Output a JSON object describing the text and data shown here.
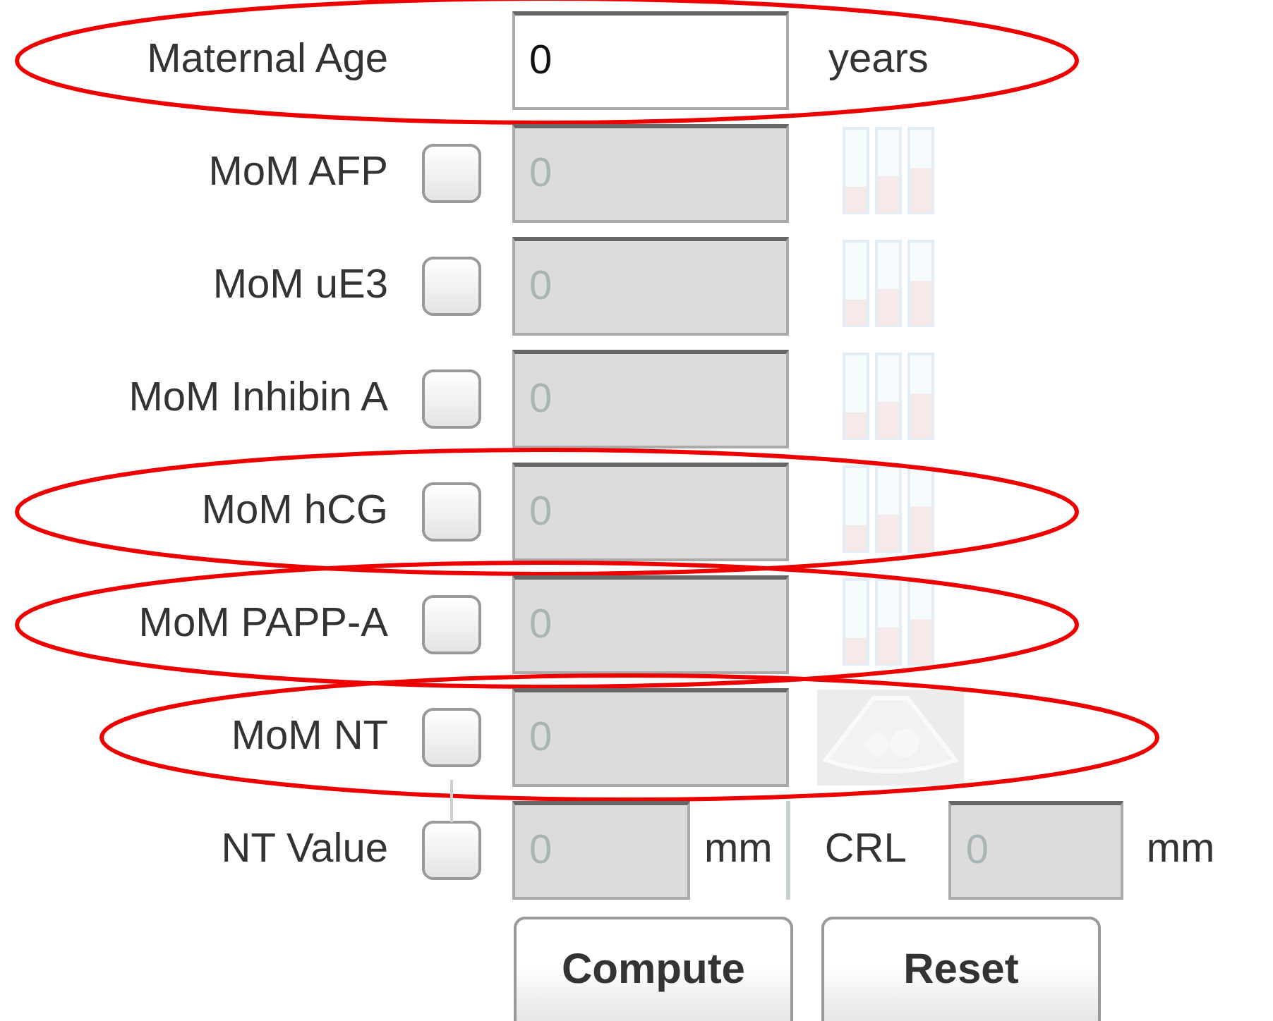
{
  "rows": [
    {
      "kind": "age",
      "label": "Maternal Age",
      "value": "0",
      "unit": "years",
      "circled": true
    },
    {
      "kind": "marker",
      "label": "MoM AFP",
      "checked": false,
      "value": "0",
      "circled": false
    },
    {
      "kind": "marker",
      "label": "MoM uE3",
      "checked": false,
      "value": "0",
      "circled": false
    },
    {
      "kind": "marker",
      "label": "MoM Inhibin A",
      "checked": false,
      "value": "0",
      "circled": false
    },
    {
      "kind": "marker",
      "label": "MoM hCG",
      "checked": false,
      "value": "0",
      "circled": true
    },
    {
      "kind": "marker",
      "label": "MoM PAPP-A",
      "checked": false,
      "value": "0",
      "circled": true
    },
    {
      "kind": "nt",
      "label": "MoM NT",
      "checked": false,
      "value": "0",
      "circled": true
    },
    {
      "kind": "nt_value",
      "label": "NT Value",
      "checked": false,
      "value": "0",
      "unit": "mm",
      "second_label": "CRL",
      "second_value": "0",
      "second_unit": "mm",
      "circled": false
    }
  ],
  "buttons": [
    "Compute",
    "Reset"
  ]
}
